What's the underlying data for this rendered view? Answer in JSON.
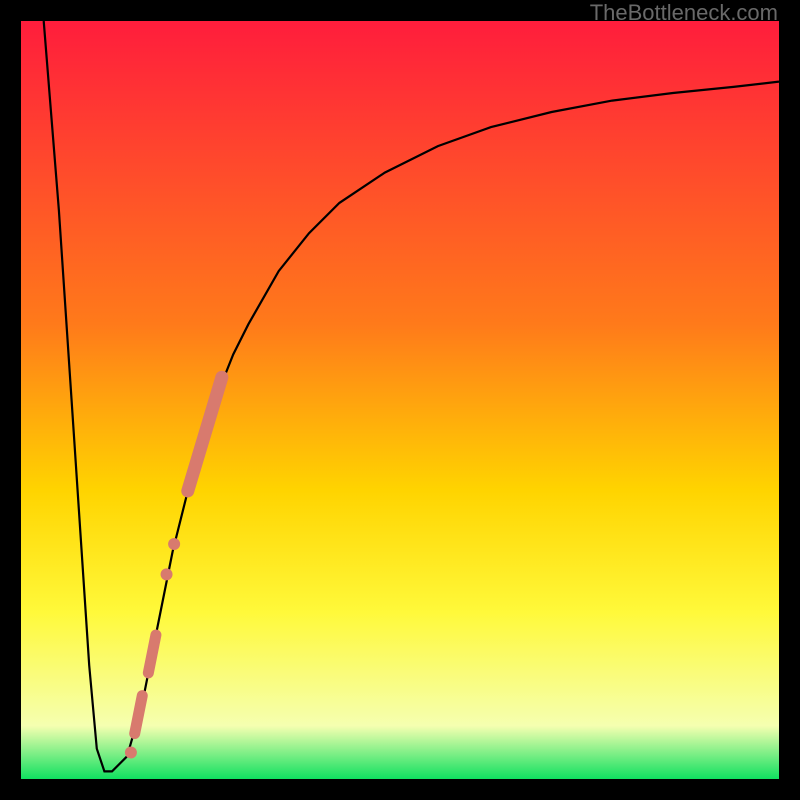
{
  "watermark": "TheBottleneck.com",
  "colors": {
    "gradient_top": "#ff1d3c",
    "gradient_mid1": "#ff7a1a",
    "gradient_mid2": "#ffd400",
    "gradient_mid3": "#fff93a",
    "gradient_mid4": "#f5ffb0",
    "gradient_bottom": "#10e060",
    "curve": "#000000",
    "marker": "#d87a6e",
    "frame_bg": "#000000"
  },
  "chart_data": {
    "type": "line",
    "title": "",
    "xlabel": "",
    "ylabel": "",
    "xlim": [
      0,
      100
    ],
    "ylim": [
      0,
      100
    ],
    "grid": false,
    "legend": false,
    "series": [
      {
        "name": "bottleneck-curve",
        "x": [
          3,
          5,
          7,
          9,
          10,
          11,
          12,
          14,
          16,
          18,
          20,
          22,
          24,
          26,
          28,
          30,
          34,
          38,
          42,
          48,
          55,
          62,
          70,
          78,
          86,
          94,
          100
        ],
        "y": [
          100,
          75,
          45,
          15,
          4,
          1,
          1,
          3,
          10,
          20,
          30,
          38,
          45,
          51,
          56,
          60,
          67,
          72,
          76,
          80,
          83.5,
          86,
          88,
          89.5,
          90.5,
          91.3,
          92
        ]
      }
    ],
    "markers": [
      {
        "name": "segment-thick",
        "shape": "thick-line",
        "x": [
          22,
          26.5
        ],
        "y": [
          38,
          53
        ]
      },
      {
        "name": "dot-1",
        "shape": "dot",
        "x": 19.2,
        "y": 27
      },
      {
        "name": "dot-2",
        "shape": "dot",
        "x": 20.2,
        "y": 31
      },
      {
        "name": "segment-short-a",
        "shape": "short-line",
        "x": [
          16.8,
          17.8
        ],
        "y": [
          14,
          19
        ]
      },
      {
        "name": "segment-short-b",
        "shape": "short-line",
        "x": [
          15,
          16
        ],
        "y": [
          6,
          11
        ]
      },
      {
        "name": "dot-bottom",
        "shape": "dot",
        "x": 14.5,
        "y": 3.5
      }
    ]
  }
}
